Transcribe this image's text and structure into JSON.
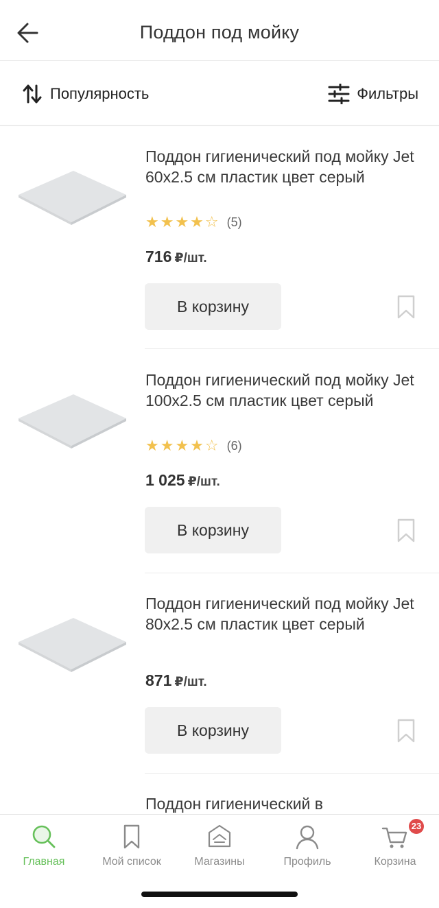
{
  "header": {
    "title": "Поддон под мойку"
  },
  "toolbar": {
    "sort_label": "Популярность",
    "filter_label": "Фильтры"
  },
  "products": [
    {
      "title": "Поддон гигиенический под мойку Jet 60x2.5 см пластик цвет серый",
      "stars": "★★★★☆",
      "rating": 4,
      "reviews": "(5)",
      "price": "716",
      "unit": "₽/шт.",
      "button": "В корзину"
    },
    {
      "title": "Поддон гигиенический под мойку Jet 100x2.5 см пластик цвет серый",
      "stars": "★★★★☆",
      "rating": 4,
      "reviews": "(6)",
      "price": "1 025",
      "unit": "₽/шт.",
      "button": "В корзину"
    },
    {
      "title": "Поддон гигиенический под мойку Jet 80x2.5 см пластик цвет серый",
      "price": "871",
      "unit": "₽/шт.",
      "button": "В корзину"
    },
    {
      "title": "Поддон гигиенический в"
    }
  ],
  "tabbar": {
    "items": [
      {
        "label": "Главная",
        "icon": "search-icon",
        "active": true
      },
      {
        "label": "Мой список",
        "icon": "bookmark-icon"
      },
      {
        "label": "Магазины",
        "icon": "store-icon"
      },
      {
        "label": "Профиль",
        "icon": "profile-icon"
      },
      {
        "label": "Корзина",
        "icon": "cart-icon",
        "badge": "23"
      }
    ]
  },
  "colors": {
    "accent": "#66c05a",
    "star": "#f2c14e",
    "badge": "#e04b4b",
    "button_bg": "#f0f0f0"
  }
}
